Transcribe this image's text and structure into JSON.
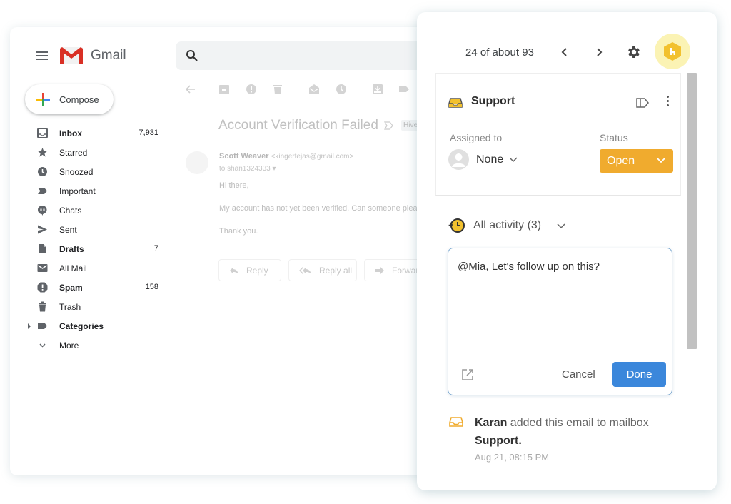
{
  "gmail": {
    "app_name": "Gmail",
    "compose_label": "Compose",
    "nav": [
      {
        "label": "Inbox",
        "count": "7,931",
        "bold": true,
        "icon": "inbox-icon"
      },
      {
        "label": "Starred",
        "count": "",
        "bold": false,
        "icon": "star-icon"
      },
      {
        "label": "Snoozed",
        "count": "",
        "bold": false,
        "icon": "clock-icon"
      },
      {
        "label": "Important",
        "count": "",
        "bold": false,
        "icon": "important-icon"
      },
      {
        "label": "Chats",
        "count": "",
        "bold": false,
        "icon": "chat-icon"
      },
      {
        "label": "Sent",
        "count": "",
        "bold": false,
        "icon": "send-icon"
      },
      {
        "label": "Drafts",
        "count": "7",
        "bold": true,
        "icon": "draft-icon"
      },
      {
        "label": "All Mail",
        "count": "",
        "bold": false,
        "icon": "mail-icon"
      },
      {
        "label": "Spam",
        "count": "158",
        "bold": true,
        "icon": "spam-icon"
      },
      {
        "label": "Trash",
        "count": "",
        "bold": false,
        "icon": "trash-icon"
      },
      {
        "label": "Categories",
        "count": "",
        "bold": true,
        "icon": "label-icon"
      },
      {
        "label": "More",
        "count": "",
        "bold": false,
        "icon": "chevron-down-icon"
      }
    ],
    "email": {
      "subject": "Account Verification Failed",
      "label_chip": "Hive",
      "sender_name": "Scott Weaver",
      "sender_email": "<kingertejas@gmail.com>",
      "to": "to shan1324333",
      "body": [
        "Hi there,",
        "My account has not yet been verified. Can someone plea",
        "Thank you."
      ]
    },
    "actions": {
      "reply": "Reply",
      "reply_all": "Reply all",
      "forward": "Forwar"
    }
  },
  "panel": {
    "pager": "24 of about 93",
    "mailbox": "Support",
    "assigned_label": "Assigned to",
    "assignee": "None",
    "status_label": "Status",
    "status": "Open",
    "activity_label": "All activity (3)",
    "comment_text": "@Mia, Let's follow up on this?",
    "cancel_label": "Cancel",
    "done_label": "Done",
    "feed": {
      "actor": "Karan",
      "action": " added this email to mailbox ",
      "target": "Support.",
      "time": "Aug 21, 08:15 PM"
    },
    "colors": {
      "status": "#f0ab2e",
      "done": "#3b87db",
      "brand": "#f2c12e"
    }
  }
}
